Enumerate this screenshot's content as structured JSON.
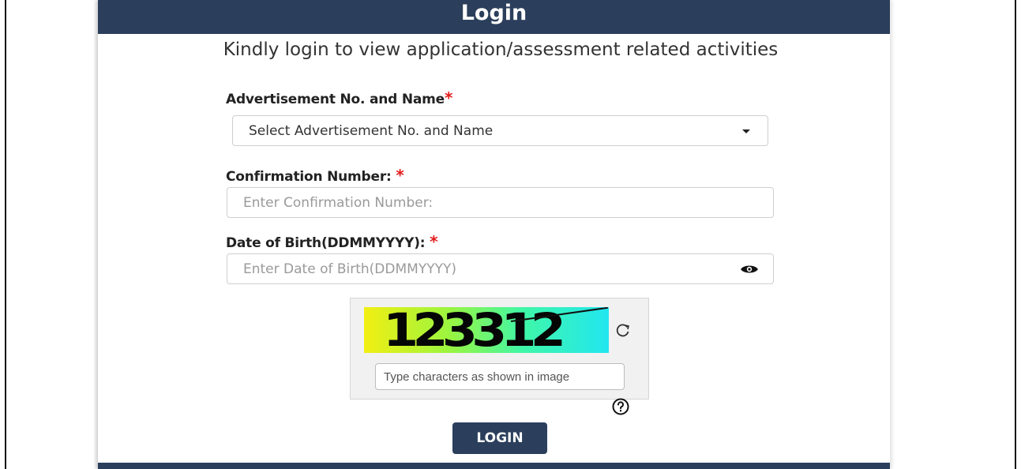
{
  "header": {
    "title": "Login"
  },
  "subtitle": "Kindly login to view application/assessment related activities",
  "advertisement": {
    "label": "Advertisement No. and Name",
    "required_mark": "*",
    "selected": "Select Advertisement No. and Name"
  },
  "confirmation": {
    "label": "Confirmation Number:",
    "required_mark": "*",
    "placeholder": "Enter Confirmation Number:"
  },
  "dob": {
    "label": "Date of Birth(DDMMYYYY):",
    "required_mark": "*",
    "placeholder": "Enter Date of Birth(DDMMYYYY)"
  },
  "captcha": {
    "code": "123312",
    "input_placeholder": "Type characters as shown in image"
  },
  "login_button": {
    "label": "LOGIN"
  },
  "colors": {
    "header_bg": "#2b3f5c",
    "required_mark": "#e31b1b"
  },
  "icons": {
    "dropdown": "caret-down-icon",
    "password_toggle": "eye-icon",
    "captcha_refresh": "refresh-icon",
    "help": "question-circle-icon"
  }
}
